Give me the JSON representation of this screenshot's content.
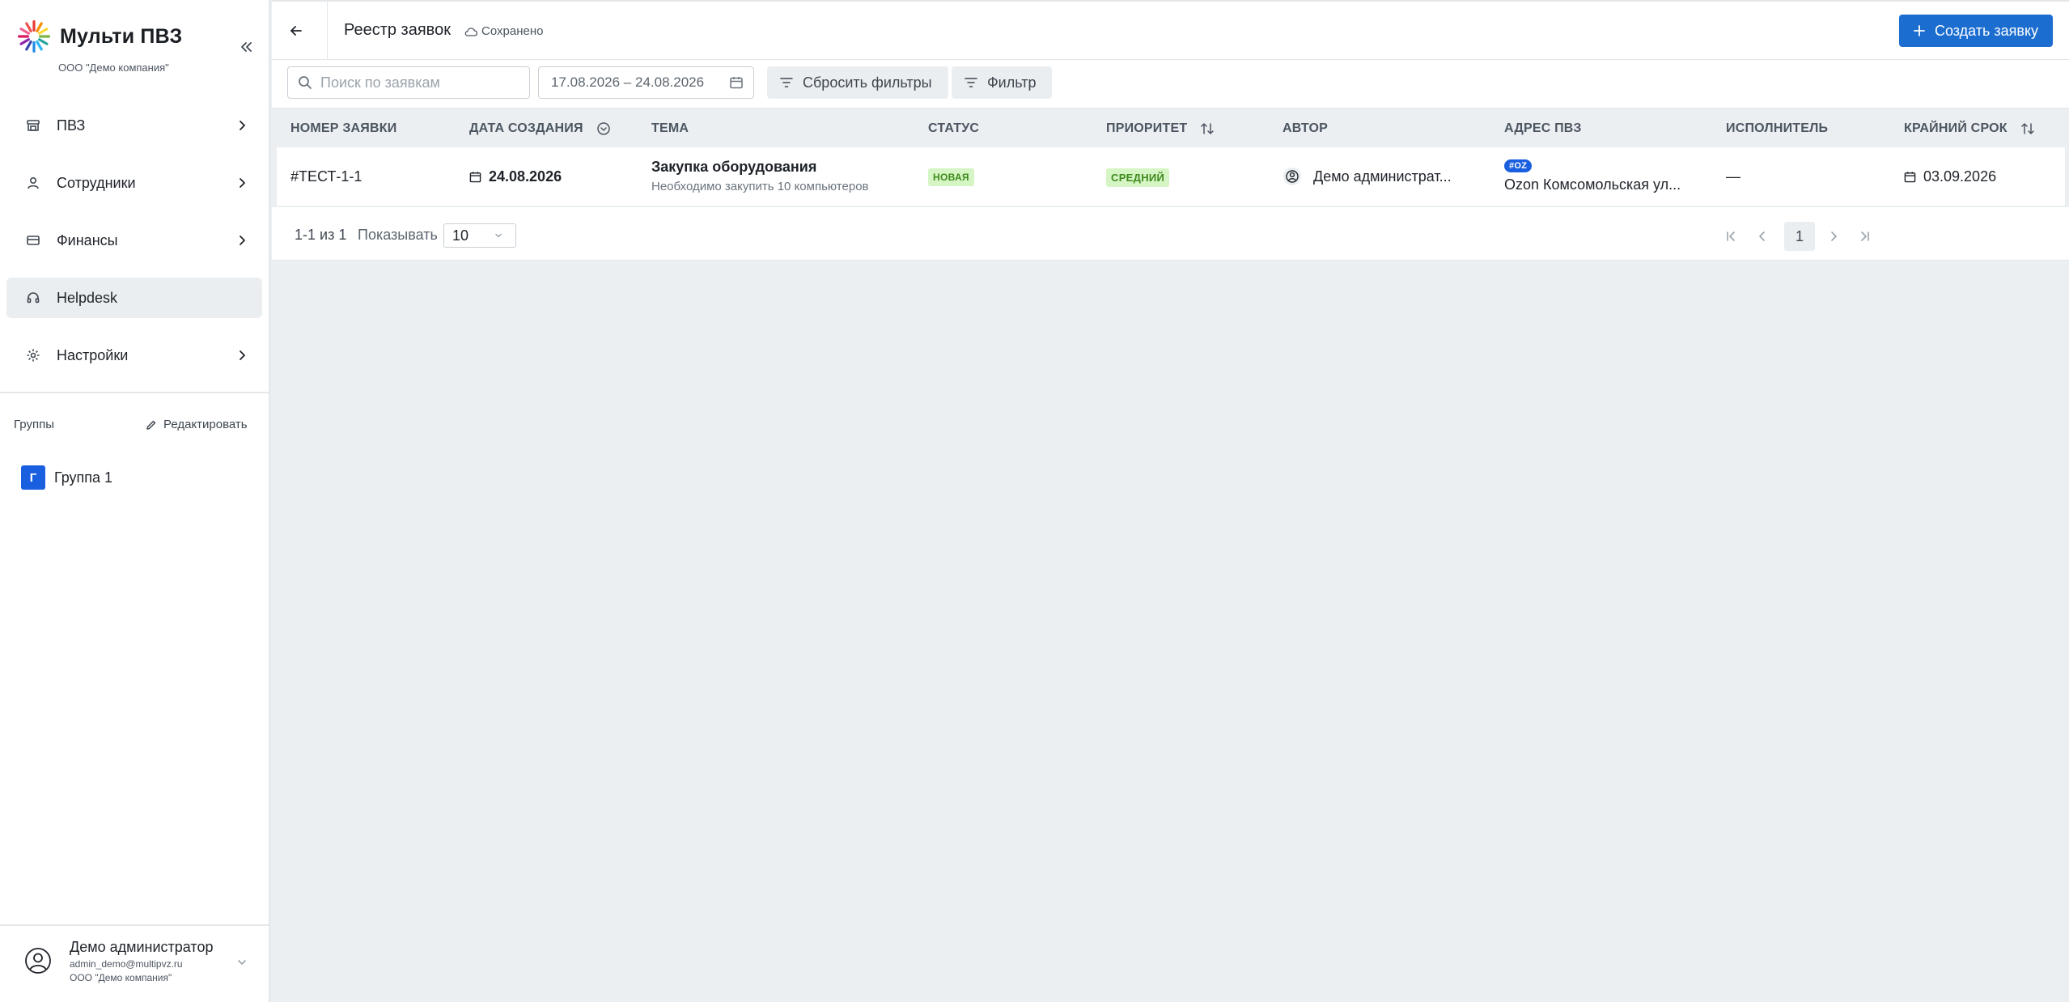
{
  "app": {
    "title": "Мульти ПВЗ",
    "company": "ООО \"Демо компания\""
  },
  "sidebar": {
    "items": [
      {
        "label": "ПВЗ",
        "icon": "store-icon",
        "has_children": true,
        "active": false
      },
      {
        "label": "Сотрудники",
        "icon": "user-icon",
        "has_children": true,
        "active": false
      },
      {
        "label": "Финансы",
        "icon": "wallet-icon",
        "has_children": true,
        "active": false
      },
      {
        "label": "Helpdesk",
        "icon": "headset-icon",
        "has_children": false,
        "active": true
      },
      {
        "label": "Настройки",
        "icon": "gear-icon",
        "has_children": true,
        "active": false
      }
    ],
    "groups_label": "Группы",
    "groups_edit_label": "Редактировать",
    "groups": [
      {
        "initial": "Г",
        "name": "Группа 1"
      }
    ],
    "user": {
      "name": "Демо администратор",
      "email": "admin_demo@multipvz.ru",
      "company": "ООО \"Демо компания\""
    }
  },
  "header": {
    "title": "Реестр заявок",
    "saved_status": "Сохранено",
    "create_button": "Создать заявку"
  },
  "filters": {
    "search_placeholder": "Поиск по заявкам",
    "date_range": "17.08.2026 – 24.08.2026",
    "reset_label": "Сбросить фильтры",
    "filter_label": "Фильтр"
  },
  "table": {
    "columns": {
      "number": "НОМЕР ЗАЯВКИ",
      "created": "ДАТА СОЗДАНИЯ",
      "subject": "ТЕМА",
      "status": "СТАТУС",
      "priority": "ПРИОРИТЕТ",
      "author": "АВТОР",
      "address": "АДРЕС ПВЗ",
      "assignee": "ИСПОЛНИТЕЛЬ",
      "deadline": "КРАЙНИЙ СРОК"
    },
    "rows": [
      {
        "number": "#ТЕСТ-1-1",
        "created": "24.08.2026",
        "subject_title": "Закупка оборудования",
        "subject_desc": "Необходимо закупить 10 компьютеров",
        "status": "НОВАЯ",
        "priority": "СРЕДНИЙ",
        "author": "Демо администрат...",
        "address_tag": "#OZ",
        "address": "Ozon Комсомольская ул...",
        "assignee": "—",
        "deadline": "03.09.2026"
      }
    ]
  },
  "pagination": {
    "range": "1-1 из 1",
    "show_label": "Показывать",
    "page_size": "10",
    "current_page": "1"
  },
  "colors": {
    "primary": "#1c6dd0",
    "group_avatar": "#1a5fe0",
    "tag_green_bg": "#d6f5c4",
    "tag_green_text": "#3d8a1d",
    "page_bg": "#ebeff2"
  }
}
